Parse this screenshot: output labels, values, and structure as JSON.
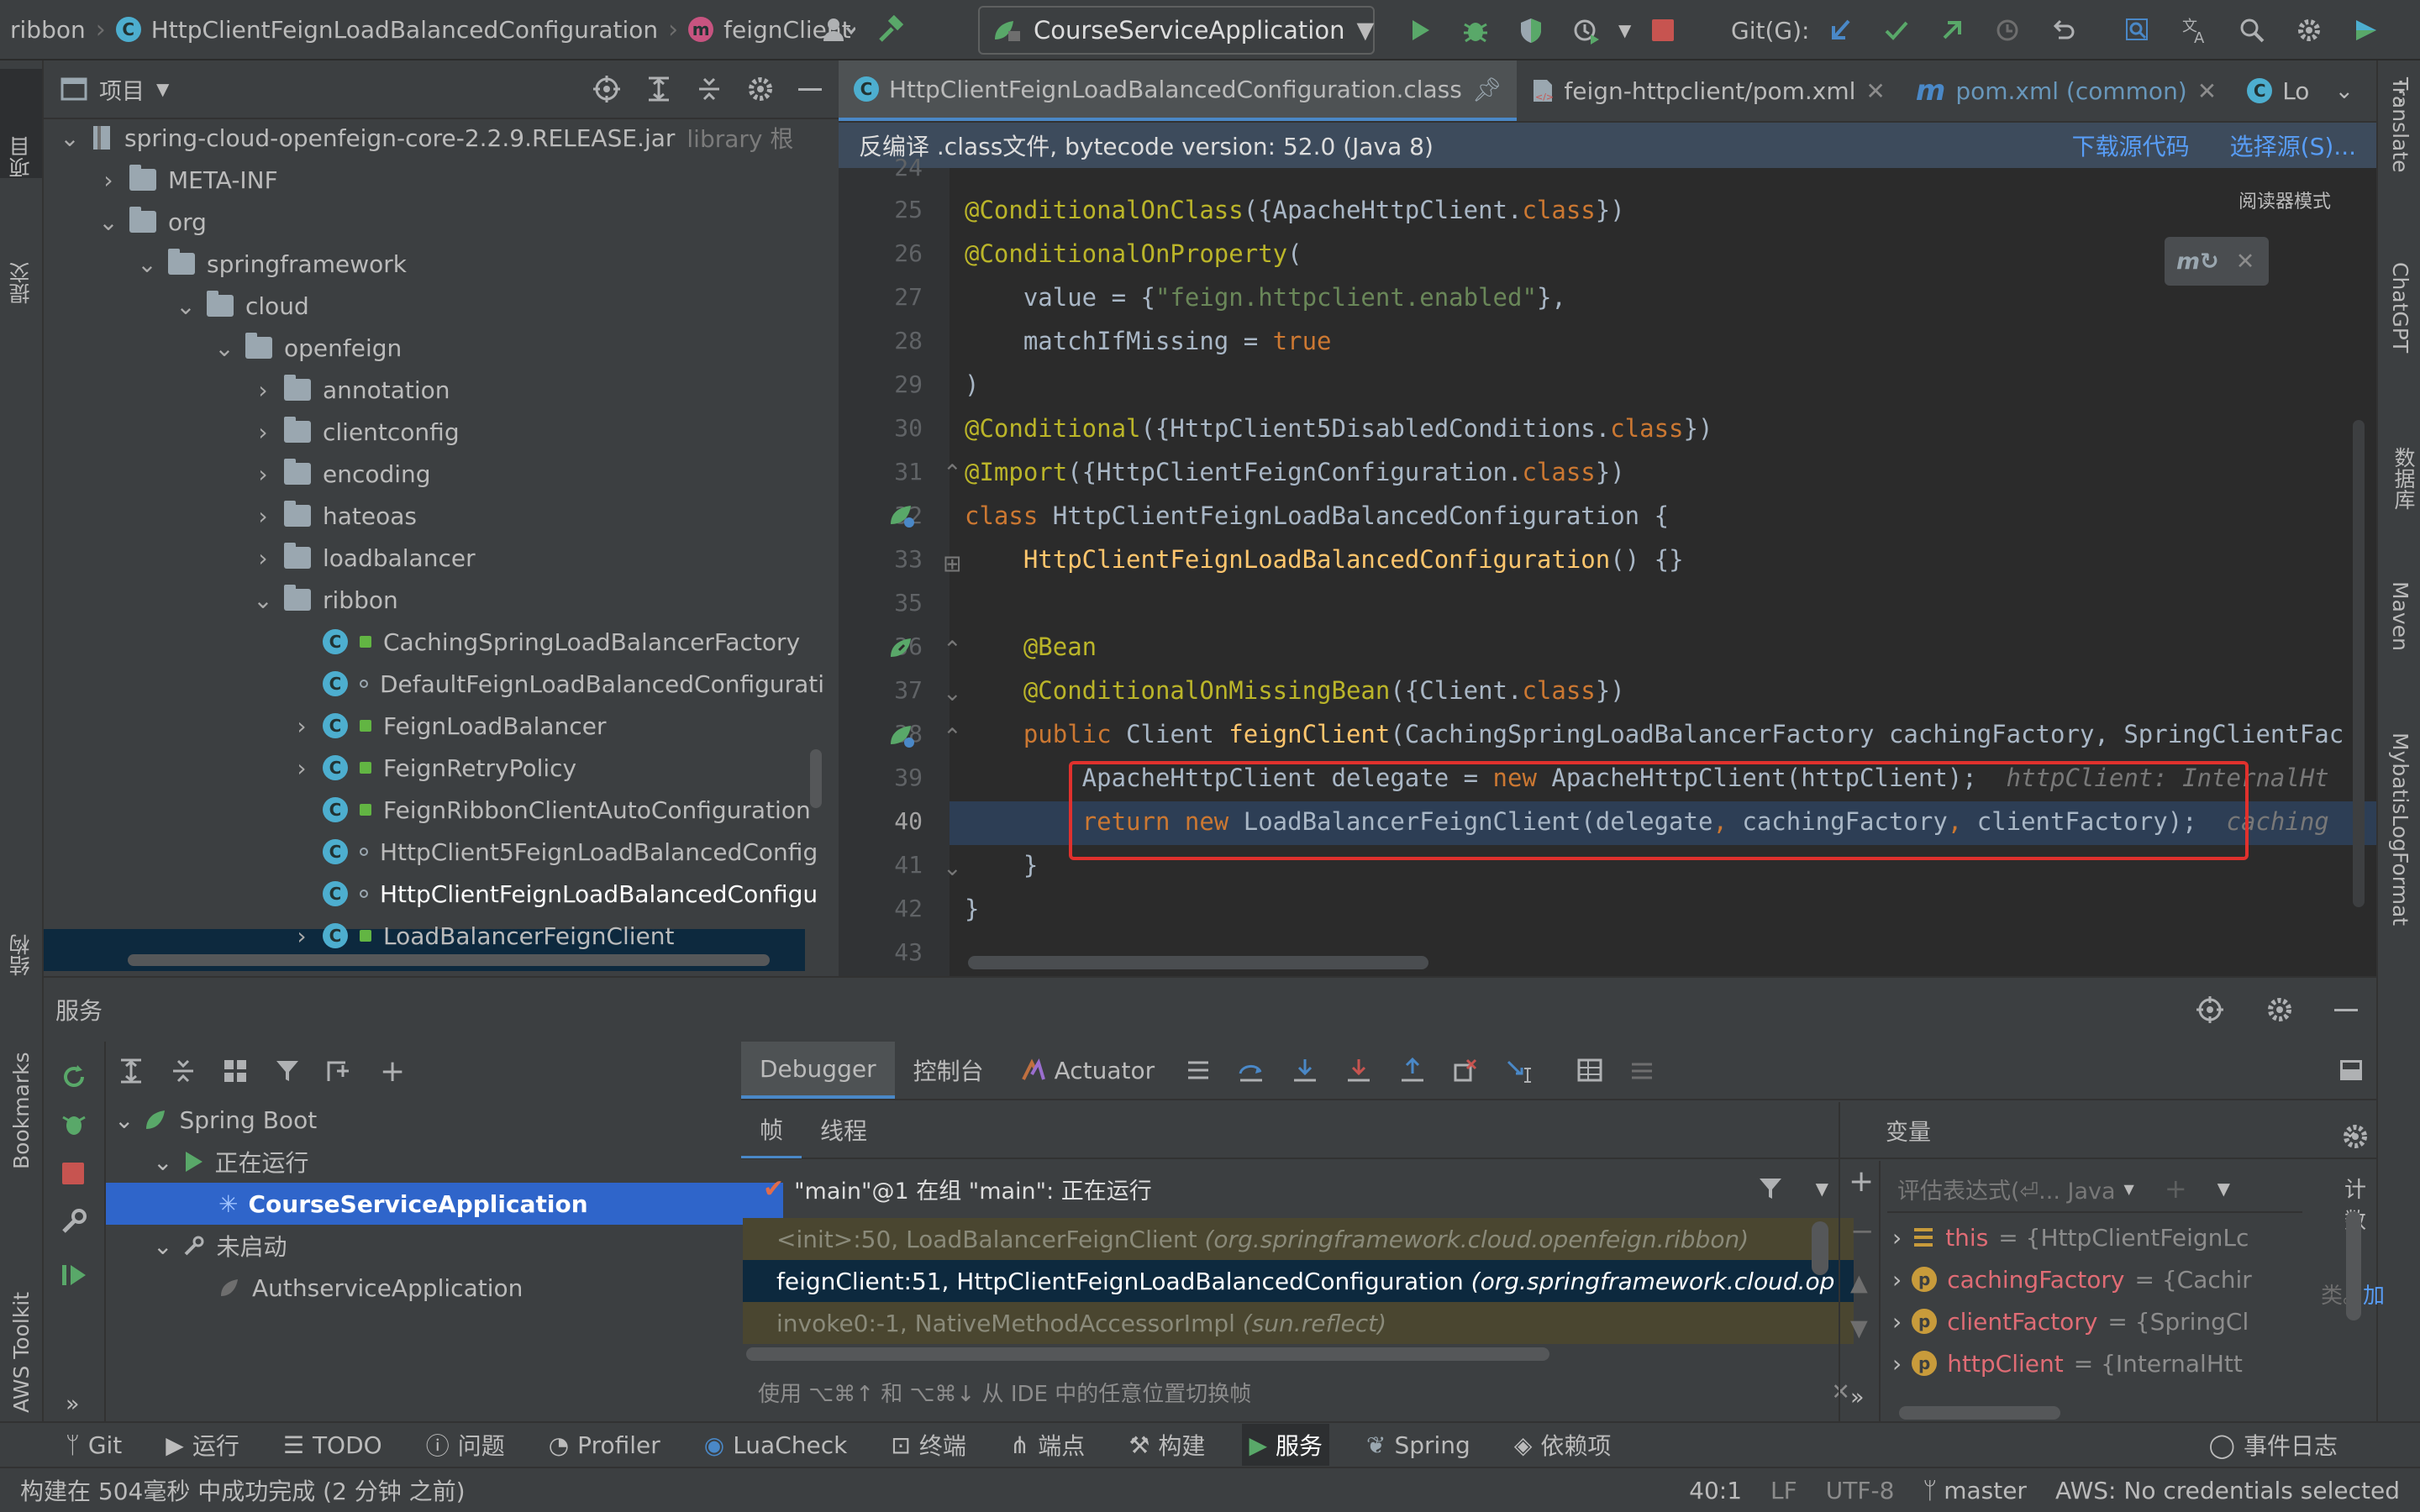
{
  "nav": {
    "crumb_module": "ribbon",
    "crumb_class": "HttpClientFeignLoadBalancedConfiguration",
    "crumb_method": "feignClient",
    "run_config": "CourseServiceApplication",
    "git_label": "Git(G):"
  },
  "left_stripe": {
    "project": "项目",
    "commit": "提交",
    "structure": "结构",
    "bookmarks": "Bookmarks",
    "aws": "AWS Toolkit"
  },
  "right_stripe": {
    "translate": "Translate",
    "chatgpt": "ChatGPT",
    "database": "数据库",
    "maven": "Maven",
    "mybatis": "MybatisLogFormat"
  },
  "project": {
    "title": "项目",
    "root": "spring-cloud-openfeign-core-2.2.9.RELEASE.jar",
    "root_suffix": "library 根",
    "items": [
      {
        "label": "META-INF"
      },
      {
        "label": "org"
      },
      {
        "label": "springframework"
      },
      {
        "label": "cloud"
      },
      {
        "label": "openfeign"
      },
      {
        "label": "annotation"
      },
      {
        "label": "clientconfig"
      },
      {
        "label": "encoding"
      },
      {
        "label": "hateoas"
      },
      {
        "label": "loadbalancer"
      },
      {
        "label": "ribbon"
      },
      {
        "label": "CachingSpringLoadBalancerFactory"
      },
      {
        "label": "DefaultFeignLoadBalancedConfigurati"
      },
      {
        "label": "FeignLoadBalancer"
      },
      {
        "label": "FeignRetryPolicy"
      },
      {
        "label": "FeignRibbonClientAutoConfiguration"
      },
      {
        "label": "HttpClient5FeignLoadBalancedConfig"
      },
      {
        "label": "HttpClientFeignLoadBalancedConfigu"
      },
      {
        "label": "LoadBalancerFeignClient"
      }
    ]
  },
  "editor": {
    "tabs": [
      {
        "label": "HttpClientFeignLoadBalancedConfiguration.class"
      },
      {
        "label": "feign-httpclient/pom.xml"
      },
      {
        "label": "pom.xml (common)"
      },
      {
        "label": "Lo"
      }
    ],
    "decompiled_notice": "反编译 .class文件, bytecode version: 52.0 (Java 8)",
    "download_sources": "下载源代码",
    "choose_sources": "选择源(S)...",
    "reader_mode": "阅读器模式",
    "line_numbers": [
      "24",
      "25",
      "26",
      "27",
      "28",
      "29",
      "30",
      "31",
      "32",
      "33",
      "35",
      "36",
      "37",
      "38",
      "39",
      "40",
      "41",
      "42",
      "43"
    ],
    "code": {
      "l25a": "@ConditionalOnClass",
      "l25b": "({ApacheHttpClient.",
      "l25c": "class",
      "l25d": "})",
      "l26a": "@ConditionalOnProperty",
      "l26b": "(",
      "l27a": "    value = {",
      "l27b": "\"feign.httpclient.enabled\"",
      "l27c": "},",
      "l28a": "    matchIfMissing = ",
      "l28b": "true",
      "l29": ")",
      "l30a": "@Conditional",
      "l30b": "({HttpClient5DisabledConditions.",
      "l30c": "class",
      "l30d": "})",
      "l31a": "@Import",
      "l31b": "({HttpClientFeignConfiguration.",
      "l31c": "class",
      "l31d": "})",
      "l32a": "class ",
      "l32b": "HttpClientFeignLoadBalancedConfiguration {",
      "l33a": "    ",
      "l33b": "HttpClientFeignLoadBalancedConfiguration",
      "l33c": "() {}",
      "l36": "    @Bean",
      "l37a": "    @ConditionalOnMissingBean",
      "l37b": "({Client.",
      "l37c": "class",
      "l37d": "})",
      "l38a": "    public ",
      "l38b": "Client ",
      "l38c": "feignClient",
      "l38d": "(CachingSpringLoadBalancerFactory cachingFactory, SpringClientFac",
      "l39a": "        ApacheHttpClient delegate = ",
      "l39b": "new ",
      "l39c": "ApacheHttpClient(httpClient);",
      "l39d": "  httpClient: InternalHt",
      "l40a": "        return new ",
      "l40b": "LoadBalancerFeignClient(delegate",
      "l40c": ", ",
      "l40d": "cachingFactory",
      "l40e": ", ",
      "l40f": "clientFactory);",
      "l40g": "  caching",
      "l41": "    }",
      "l42": "}"
    }
  },
  "services": {
    "title": "服务",
    "tree": {
      "spring_boot": "Spring Boot",
      "running": "正在运行",
      "course": "CourseServiceApplication",
      "not_started": "未启动",
      "auth": "AuthserviceApplication"
    },
    "debug_tabs": {
      "debugger": "Debugger",
      "console": "控制台",
      "actuator": "Actuator"
    },
    "frames_tab": "帧",
    "threads_tab": "线程",
    "variables_tab": "变量",
    "thread_status": "\"main\"@1 在组 \"main\": 正在运行",
    "frames": [
      {
        "method": "<init>:50, LoadBalancerFeignClient",
        "pkg": "(org.springframework.cloud.openfeign.ribbon)"
      },
      {
        "method": "feignClient:51, HttpClientFeignLoadBalancedConfiguration",
        "pkg": "(org.springframework.cloud.op"
      },
      {
        "method": "invoke0:-1, NativeMethodAccessorImpl",
        "pkg": "(sun.reflect)"
      }
    ],
    "frames_hint": "使用 ⌥⌘↑ 和 ⌥⌘↓ 从 IDE 中的任意位置切换帧",
    "eval_placeholder": "评估表达式(⏎... Java",
    "variables": [
      {
        "name": "this",
        "value": "= {HttpClientFeignLc"
      },
      {
        "name": "cachingFactory",
        "value": "= {Cachir"
      },
      {
        "name": "clientFactory",
        "value": "= {SpringCl"
      },
      {
        "name": "httpClient",
        "value": "= {InternalHtt"
      }
    ],
    "side_text_1": "计数",
    "side_text_2": "类。",
    "side_text_3": "加"
  },
  "toolbar": {
    "git": "Git",
    "run": "运行",
    "todo": "TODO",
    "problems": "问题",
    "profiler": "Profiler",
    "luacheck": "LuaCheck",
    "terminal": "终端",
    "endpoints": "端点",
    "build": "构建",
    "services": "服务",
    "spring": "Spring",
    "deps": "依赖项",
    "event_log": "事件日志"
  },
  "status": {
    "build_msg": "构建在 504毫秒 中成功完成 (2 分钟 之前)",
    "position": "40:1",
    "line_sep": "LF",
    "encoding": "UTF-8",
    "branch": "master",
    "aws": "AWS: No credentials selected"
  },
  "colors": {
    "accent": "#4a88c7",
    "selection": "#2f65ca",
    "highlight_box": "#e0312d",
    "run_green": "#59a869",
    "stop_red": "#c75450"
  }
}
